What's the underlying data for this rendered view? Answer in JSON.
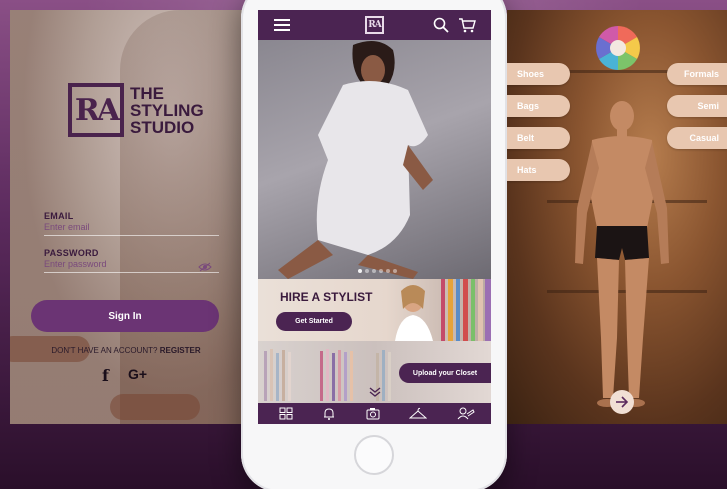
{
  "colors": {
    "brand_purple": "#4b2452",
    "button_purple": "#6b3474",
    "pill_peach": "#e8c7b0"
  },
  "login": {
    "logo_mark": "RA",
    "logo_lines": [
      "THE",
      "STYLING",
      "STUDIO"
    ],
    "email_label": "EMAIL",
    "email_placeholder": "Enter email",
    "password_label": "PASSWORD",
    "password_placeholder": "Enter password",
    "signin_label": "Sign In",
    "no_account_text": "DON'T HAVE AN ACCOUNT?",
    "register_label": "REGISTER",
    "facebook_glyph": "f",
    "google_glyph": "G+"
  },
  "phone": {
    "brand_mark": "RA",
    "icons": [
      "menu-icon",
      "search-icon",
      "cart-icon"
    ],
    "carousel": {
      "total": 6,
      "active": 0
    },
    "stylist_title": "HIRE A STYLIST",
    "get_started_label": "Get Started",
    "upload_label": "Upload your Closet",
    "bottom_nav": [
      "grid-icon",
      "bell-icon",
      "camera-icon",
      "hanger-icon",
      "stylist-icon"
    ]
  },
  "wardrobe": {
    "left_categories": [
      "Shoes",
      "Bags",
      "Belt",
      "Hats"
    ],
    "right_categories": [
      "Formals",
      "Semi",
      "Casual"
    ],
    "next_icon": "arrow-right-icon"
  }
}
